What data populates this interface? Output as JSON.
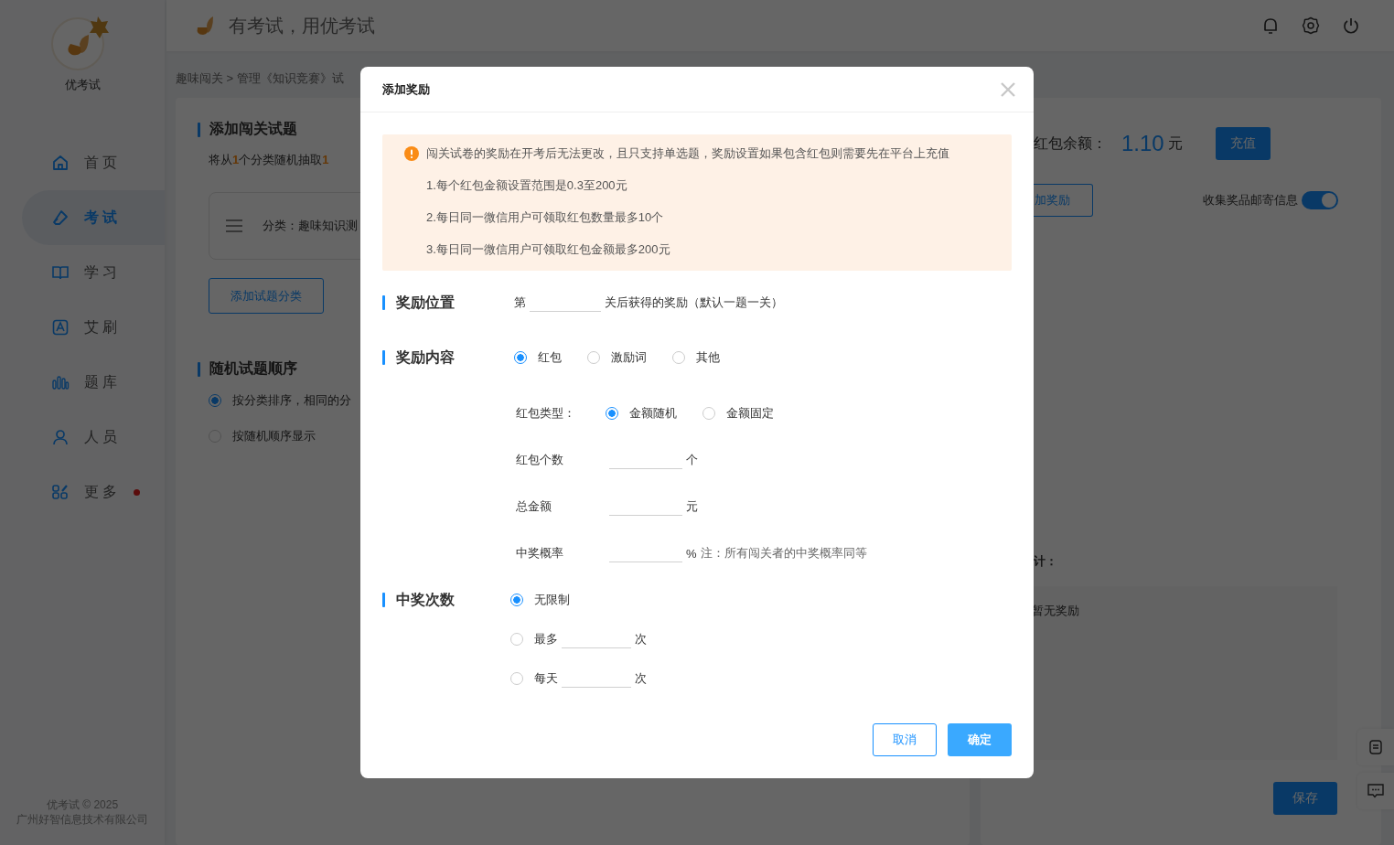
{
  "sidebar": {
    "brand": "优考试",
    "items": [
      {
        "label": "首页",
        "selected": false,
        "dot": false
      },
      {
        "label": "考试",
        "selected": true,
        "dot": false
      },
      {
        "label": "学习",
        "selected": false,
        "dot": false
      },
      {
        "label": "艾刷",
        "selected": false,
        "dot": false
      },
      {
        "label": "题库",
        "selected": false,
        "dot": false
      },
      {
        "label": "人员",
        "selected": false,
        "dot": false
      },
      {
        "label": "更多",
        "selected": false,
        "dot": true
      }
    ],
    "footer": [
      "优考试 © 2025",
      "广州好智信息技术有限公司"
    ]
  },
  "header": {
    "slogan": "有考试，用优考试"
  },
  "breadcrumb": "趣味闯关 > 管理《知识竞赛》试",
  "left_card": {
    "section_1": {
      "title": "添加闯关试题",
      "summary": [
        {
          "text": "将从",
          "highlight": false
        },
        {
          "text": "1",
          "highlight": true
        },
        {
          "text": "个分类随机抽取",
          "highlight": false
        },
        {
          "text": "1",
          "highlight": true
        }
      ],
      "category": "分类：趣味知识测",
      "add_button": "添加试题分类"
    },
    "section_2": {
      "title": "随机试题顺序",
      "options": [
        {
          "label": "按分类排序，相同的分",
          "selected": true
        },
        {
          "label": "按随机顺序显示",
          "selected": false
        }
      ]
    }
  },
  "right_card": {
    "balance_label": "红包余额：",
    "balance": "1.10",
    "unit": "元",
    "recharge_button": "充值",
    "add_reward_button": "加奖励",
    "toggle": {
      "label": "收集奖品邮寄信息",
      "on": true
    },
    "stats_label": "计：",
    "empty_text": "暂无奖励",
    "save_button": "保存"
  },
  "modal": {
    "title": "添加奖励",
    "notice": {
      "headline": "闯关试卷的奖励在开考后无法更改，且只支持单选题，奖励设置如果包含红包则需要先在平台上充值",
      "lines": [
        "1.每个红包金额设置范围是0.3至200元",
        "2.每日同一微信用户可领取红包数量最多10个",
        "3.每日同一微信用户可领取红包金额最多200元"
      ]
    },
    "position": {
      "label": "奖励位置",
      "prefix": "第",
      "suffix": "关后获得的奖励（默认一题一关）"
    },
    "content": {
      "label": "奖励内容",
      "options": [
        {
          "label": "红包",
          "selected": true
        },
        {
          "label": "激励词",
          "selected": false
        },
        {
          "label": "其他",
          "selected": false
        }
      ],
      "packet_type": {
        "label": "红包类型：",
        "options": [
          {
            "label": "金额随机",
            "selected": true
          },
          {
            "label": "金额固定",
            "selected": false
          }
        ]
      },
      "fields": [
        {
          "label": "红包个数",
          "unit": "个"
        },
        {
          "label": "总金额",
          "unit": "元"
        },
        {
          "label": "中奖概率",
          "unit": "%",
          "note": "注：所有闯关者的中奖概率同等"
        }
      ]
    },
    "win_count": {
      "label": "中奖次数",
      "options": [
        {
          "kind": "plain",
          "label": "无限制",
          "selected": true
        },
        {
          "kind": "limit",
          "label": "最多",
          "unit": "次",
          "selected": false
        },
        {
          "kind": "limit",
          "label": "每天",
          "unit": "次",
          "selected": false
        }
      ]
    },
    "cancel_button": "取消",
    "ok_button": "确定"
  }
}
